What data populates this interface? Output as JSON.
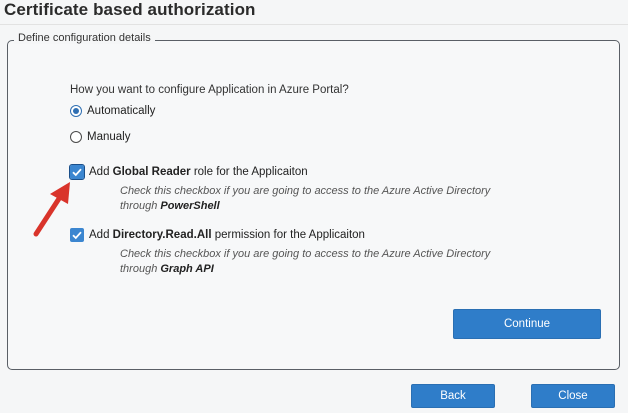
{
  "page": {
    "title": "Certificate based authorization"
  },
  "group": {
    "legend": "Define configuration details"
  },
  "config": {
    "question": "How you want to configure Application in Azure Portal?",
    "options": [
      {
        "label": "Automatically",
        "selected": true
      },
      {
        "label": "Manualy",
        "selected": false
      }
    ]
  },
  "global_reader": {
    "prefix": "Add ",
    "bold": "Global Reader",
    "suffix": " role for the Applicaiton",
    "checked": true,
    "hint_line1": "Check this checkbox if you are going to access to the Azure Active Directory",
    "hint_line2_prefix": "through ",
    "hint_line2_bold": "PowerShell"
  },
  "directory_read": {
    "prefix": "Add ",
    "bold": "Directory.Read.All",
    "suffix": " permission for the Applicaiton",
    "checked": true,
    "hint_line1": "Check this checkbox if you are going to access to the Azure Active Directory",
    "hint_line2_prefix": "through ",
    "hint_line2_bold": "Graph API"
  },
  "buttons": {
    "continue": "Continue",
    "back": "Back",
    "close": "Close"
  },
  "colors": {
    "accent": "#2f7dc9",
    "arrow": "#d9342b"
  }
}
